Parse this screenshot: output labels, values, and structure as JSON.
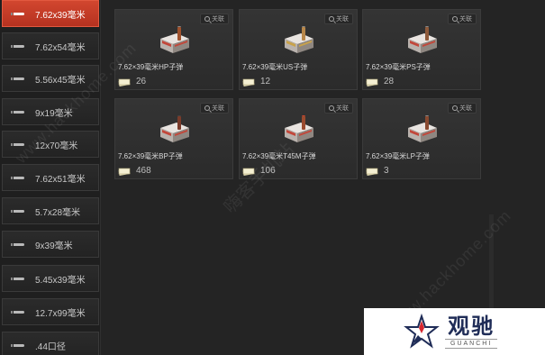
{
  "sidebar": {
    "items": [
      {
        "label": "7.62x39毫米",
        "active": true
      },
      {
        "label": "7.62x54毫米",
        "active": false
      },
      {
        "label": "5.56x45毫米",
        "active": false
      },
      {
        "label": "9x19毫米",
        "active": false
      },
      {
        "label": "12x70毫米",
        "active": false
      },
      {
        "label": "7.62x51毫米",
        "active": false
      },
      {
        "label": "5.7x28毫米",
        "active": false
      },
      {
        "label": "9x39毫米",
        "active": false
      },
      {
        "label": "5.45x39毫米",
        "active": false
      },
      {
        "label": "12.7x99毫米",
        "active": false
      },
      {
        "label": ".44口径",
        "active": false
      }
    ]
  },
  "cards": [
    {
      "name": "7.62×39毫米HP子弹",
      "quantity": "26",
      "details_label": "关联"
    },
    {
      "name": "7.62×39毫米US子弹",
      "quantity": "12",
      "details_label": "关联"
    },
    {
      "name": "7.62×39毫米PS子弹",
      "quantity": "28",
      "details_label": "关联"
    },
    {
      "name": "7.62×39毫米BP子弹",
      "quantity": "468",
      "details_label": "关联"
    },
    {
      "name": "7.62×39毫米T45M子弹",
      "quantity": "106",
      "details_label": "关联"
    },
    {
      "name": "7.62×39毫米LP子弹",
      "quantity": "3",
      "details_label": "关联"
    }
  ],
  "watermarks": {
    "url_left": "www.hackhome.com",
    "url_right": "www.hackhome.com",
    "cn_text": "嗨客手机站"
  },
  "logo": {
    "cn": "观驰",
    "en": "GUANCHI"
  },
  "colors": {
    "accent_active": "#c23a26",
    "background": "#242424",
    "card": "#303030"
  }
}
